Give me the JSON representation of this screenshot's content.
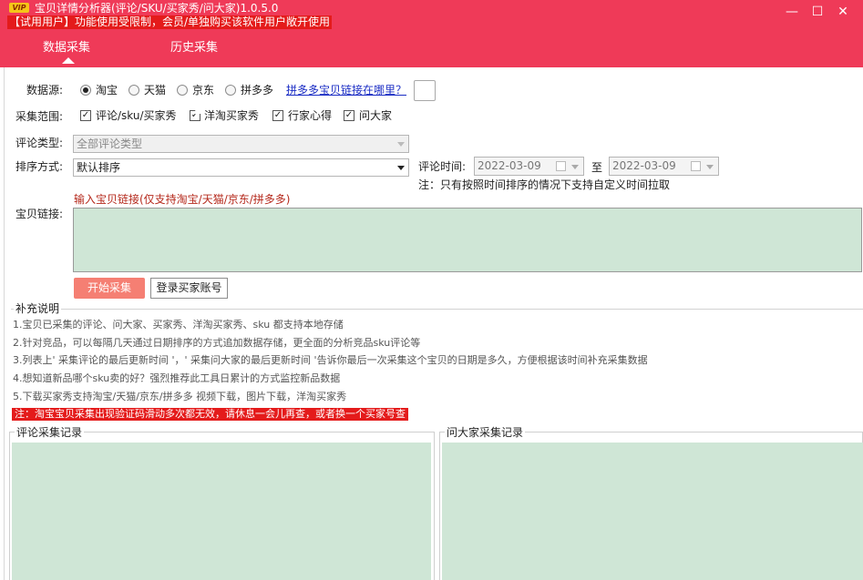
{
  "window": {
    "vip_badge": "VIP",
    "title": "宝贝详情分析器(评论/SKU/买家秀/问大家)1.0.5.0",
    "trial_notice": "【试用用户】功能使用受限制，会员/单独购买该软件用户敞开使用",
    "minimize": "—",
    "maximize": "☐",
    "close": "✕"
  },
  "tabs": [
    {
      "label": "数据采集",
      "active": true
    },
    {
      "label": "历史采集",
      "active": false
    }
  ],
  "form": {
    "source_label": "数据源:",
    "sources": [
      {
        "label": "淘宝",
        "selected": true
      },
      {
        "label": "天猫",
        "selected": false
      },
      {
        "label": "京东",
        "selected": false
      },
      {
        "label": "拼多多",
        "selected": false
      }
    ],
    "pdd_help_link": "拼多多宝贝链接在哪里？",
    "scope_label": "采集范围:",
    "scopes": [
      {
        "label": "评论/sku/买家秀",
        "checked": true
      },
      {
        "label": "洋淘买家秀",
        "checked": true
      },
      {
        "label": "行家心得",
        "checked": true
      },
      {
        "label": "问大家",
        "checked": true
      }
    ],
    "review_type_label": "评论类型:",
    "review_type_value": "全部评论类型",
    "sort_label": "排序方式:",
    "sort_value": "默认排序",
    "review_time_label": "评论时间:",
    "date_from": "2022-03-09",
    "date_to_label": "至",
    "date_to": "2022-03-09",
    "time_note": "注：只有按照时间排序的情况下支持自定义时间拉取",
    "link_hint": "输入宝贝链接(仅支持淘宝/天猫/京东/拼多多)",
    "link_label": "宝贝链接:",
    "link_value": "",
    "start_button": "开始采集",
    "login_button": "登录买家账号"
  },
  "notes": {
    "title": "补充说明",
    "items": [
      "1.宝贝已采集的评论、问大家、买家秀、洋淘买家秀、sku 都支持本地存储",
      "2.针对竞品，可以每隔几天通过日期排序的方式追加数据存储，更全面的分析竞品sku评论等",
      "3.列表上' 采集评论的最后更新时间 '，' 采集问大家的最后更新时间 '告诉你最后一次采集这个宝贝的日期是多久，方便根据该时间补充采集数据",
      "4.想知道新品哪个sku卖的好？强烈推荐此工具日累计的方式监控新品数据",
      "5.下载买家秀支持淘宝/天猫/京东/拼多多 视频下载，图片下载，洋淘买家秀"
    ],
    "warning": "注：淘宝宝贝采集出现验证码滑动多次都无效，请休息一会儿再查，或者换一个买家号查"
  },
  "records": {
    "review_title": "评论采集记录",
    "qa_title": "问大家采集记录"
  },
  "colors": {
    "header": "#ef3a58",
    "trial_bar": "#e41b1b",
    "panel_green": "#cfe6d6",
    "start_button": "#f57f73",
    "link_hint": "#b5291c",
    "help_link": "#1a2cc4"
  }
}
